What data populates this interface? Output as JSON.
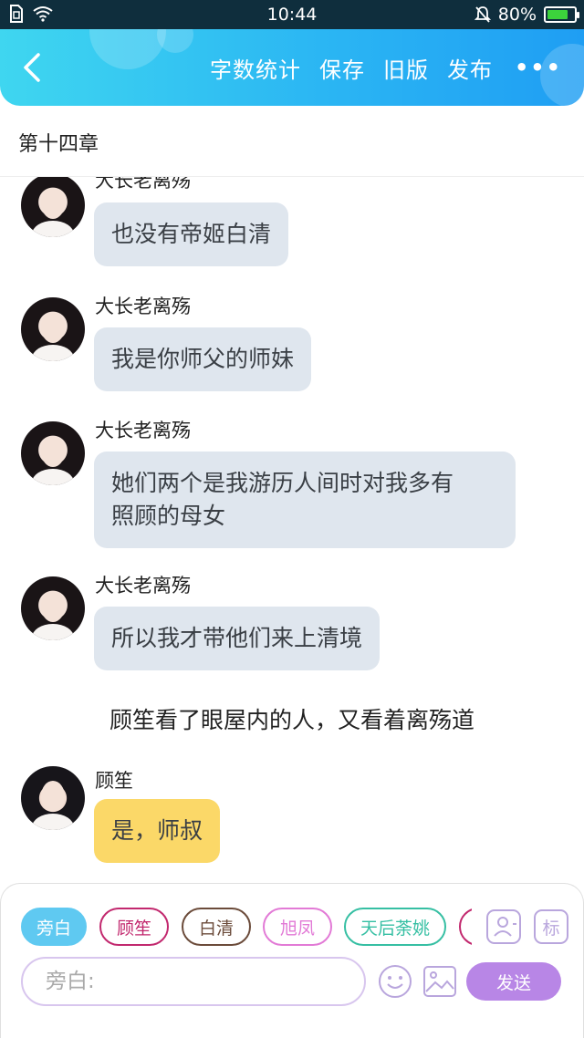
{
  "status_bar": {
    "time": "10:44",
    "battery": "80%",
    "battery_level": 0.8
  },
  "header": {
    "actions": [
      {
        "label": "字数统计"
      },
      {
        "label": "保存"
      },
      {
        "label": "旧版"
      },
      {
        "label": "发布"
      }
    ],
    "more": "•••"
  },
  "chapter": {
    "title": "第十四章"
  },
  "messages": [
    {
      "sender": "大长老离殇",
      "text": "也没有帝姬白清"
    },
    {
      "sender": "大长老离殇",
      "text": "我是你师父的师妹"
    },
    {
      "sender": "大长老离殇",
      "text_line1": "她们两个是我游历人间时对我多有",
      "text_line2": "照顾的母女"
    },
    {
      "sender": "大长老离殇",
      "text": "所以我才带他们来上清境"
    }
  ],
  "narration": "顾笙看了眼屋内的人，又看着离殇道",
  "reply": {
    "sender": "顾笙",
    "text": "是，师叔"
  },
  "input_panel": {
    "roles": [
      {
        "label": "旁白",
        "color": "#5fc9f1"
      },
      {
        "label": "顾笙",
        "color": "#c2286e"
      },
      {
        "label": "白清",
        "color": "#6b4b3a"
      },
      {
        "label": "旭凤",
        "color": "#e27ad6"
      },
      {
        "label": "天后荼姚",
        "color": "#36bfa3"
      },
      {
        "label": "",
        "color": "#c2286e"
      }
    ],
    "placeholder": "旁白:",
    "send_label": "发送",
    "tag_icon_label": "标",
    "accent_color": "#b886e6"
  }
}
